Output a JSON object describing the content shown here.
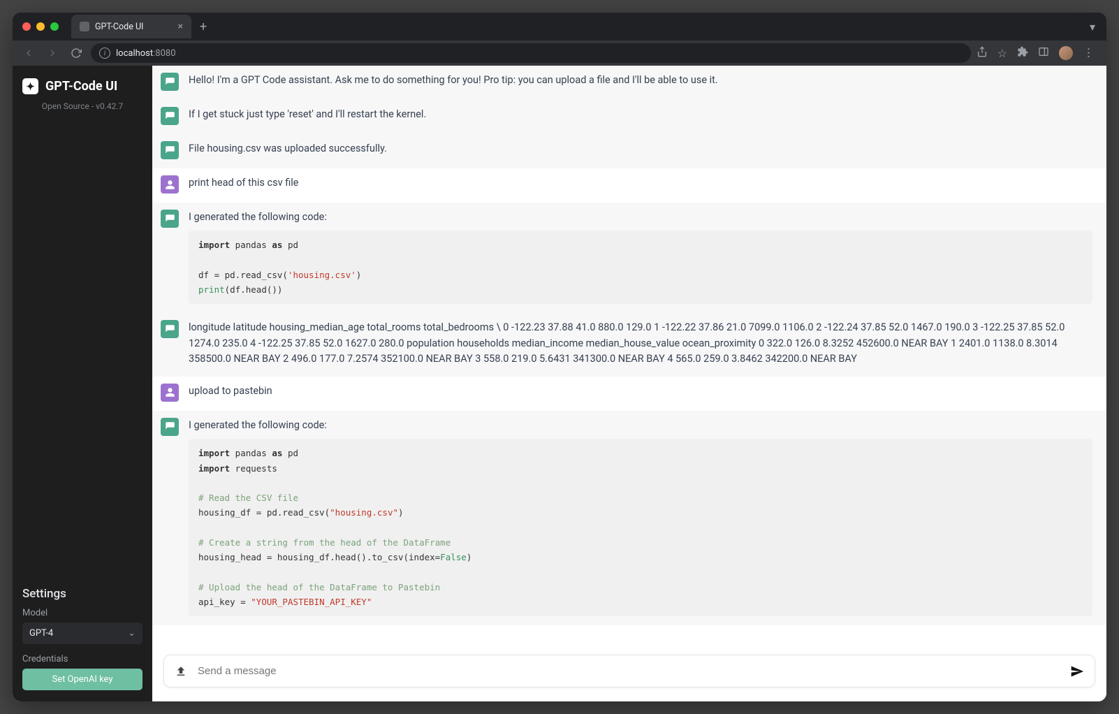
{
  "browser": {
    "tab_title": "GPT-Code UI",
    "url_host": "localhost",
    "url_port": ":8080"
  },
  "sidebar": {
    "app_title": "GPT-Code UI",
    "subtitle": "Open Source - v0.42.7",
    "settings_header": "Settings",
    "model_label": "Model",
    "model_value": "GPT-4",
    "credentials_label": "Credentials",
    "set_key_button": "Set OpenAI key"
  },
  "messages": {
    "m0": "Hello! I'm a GPT Code assistant. Ask me to do something for you! Pro tip: you can upload a file and I'll be able to use it.",
    "m1": "If I get stuck just type 'reset' and I'll restart the kernel.",
    "m2": "File housing.csv was uploaded successfully.",
    "m3": "print head of this csv file",
    "m4_intro": "I generated the following code:",
    "m5": "longitude latitude housing_median_age total_rooms total_bedrooms \\ 0 -122.23 37.88 41.0 880.0 129.0 1 -122.22 37.86 21.0 7099.0 1106.0 2 -122.24 37.85 52.0 1467.0 190.0 3 -122.25 37.85 52.0 1274.0 235.0 4 -122.25 37.85 52.0 1627.0 280.0 population households median_income median_house_value ocean_proximity 0 322.0 126.0 8.3252 452600.0 NEAR BAY 1 2401.0 1138.0 8.3014 358500.0 NEAR BAY 2 496.0 177.0 7.2574 352100.0 NEAR BAY 3 558.0 219.0 5.6431 341300.0 NEAR BAY 4 565.0 259.0 3.8462 342200.0 NEAR BAY",
    "m6": "upload to pastebin",
    "m7_intro": "I generated the following code:"
  },
  "code1": {
    "l1a": "import",
    "l1b": " pandas ",
    "l1c": "as",
    "l1d": " pd",
    "l3": "df = pd.read_csv(",
    "l3s": "'housing.csv'",
    "l3e": ")",
    "l4a": "print",
    "l4b": "(df.head())"
  },
  "code2": {
    "l1a": "import",
    "l1b": " pandas ",
    "l1c": "as",
    "l1d": " pd",
    "l2a": "import",
    "l2b": " requests",
    "c1": "# Read the CSV file",
    "l3": "housing_df = pd.read_csv(",
    "l3s": "\"housing.csv\"",
    "l3e": ")",
    "c2": "# Create a string from the head of the DataFrame",
    "l4": "housing_head = housing_df.head().to_csv(index=",
    "l4b": "False",
    "l4e": ")",
    "c3": "# Upload the head of the DataFrame to Pastebin",
    "l5": "api_key = ",
    "l5s": "\"YOUR_PASTEBIN_API_KEY\""
  },
  "composer": {
    "placeholder": "Send a message"
  }
}
